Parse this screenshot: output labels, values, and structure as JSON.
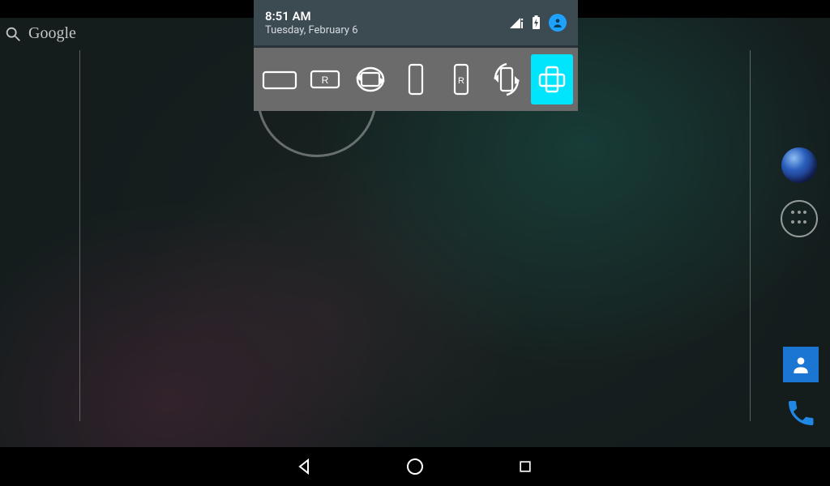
{
  "status": {
    "time": "8:51 AM",
    "date": "Tuesday, February 6"
  },
  "search": {
    "label": "Google"
  },
  "rotation_options": [
    {
      "id": "landscape",
      "label_letter": "",
      "selected": false
    },
    {
      "id": "landscape-reverse",
      "label_letter": "R",
      "selected": false
    },
    {
      "id": "landscape-auto",
      "label_letter": "",
      "selected": false
    },
    {
      "id": "portrait",
      "label_letter": "",
      "selected": false
    },
    {
      "id": "portrait-reverse",
      "label_letter": "R",
      "selected": false
    },
    {
      "id": "portrait-auto",
      "label_letter": "",
      "selected": false
    },
    {
      "id": "full-auto",
      "label_letter": "",
      "selected": true
    }
  ],
  "colors": {
    "panel_bg": "#3c4a52",
    "row_bg": "#6b6b6b",
    "accent_cyan": "#00e5fb",
    "avatar_blue": "#1fa2ff",
    "contacts_blue": "#1a76d2",
    "phone_blue": "#1f88e5"
  },
  "dock": [
    {
      "id": "browser"
    },
    {
      "id": "all-apps"
    }
  ],
  "dock_lower": [
    {
      "id": "contacts"
    },
    {
      "id": "phone"
    }
  ]
}
